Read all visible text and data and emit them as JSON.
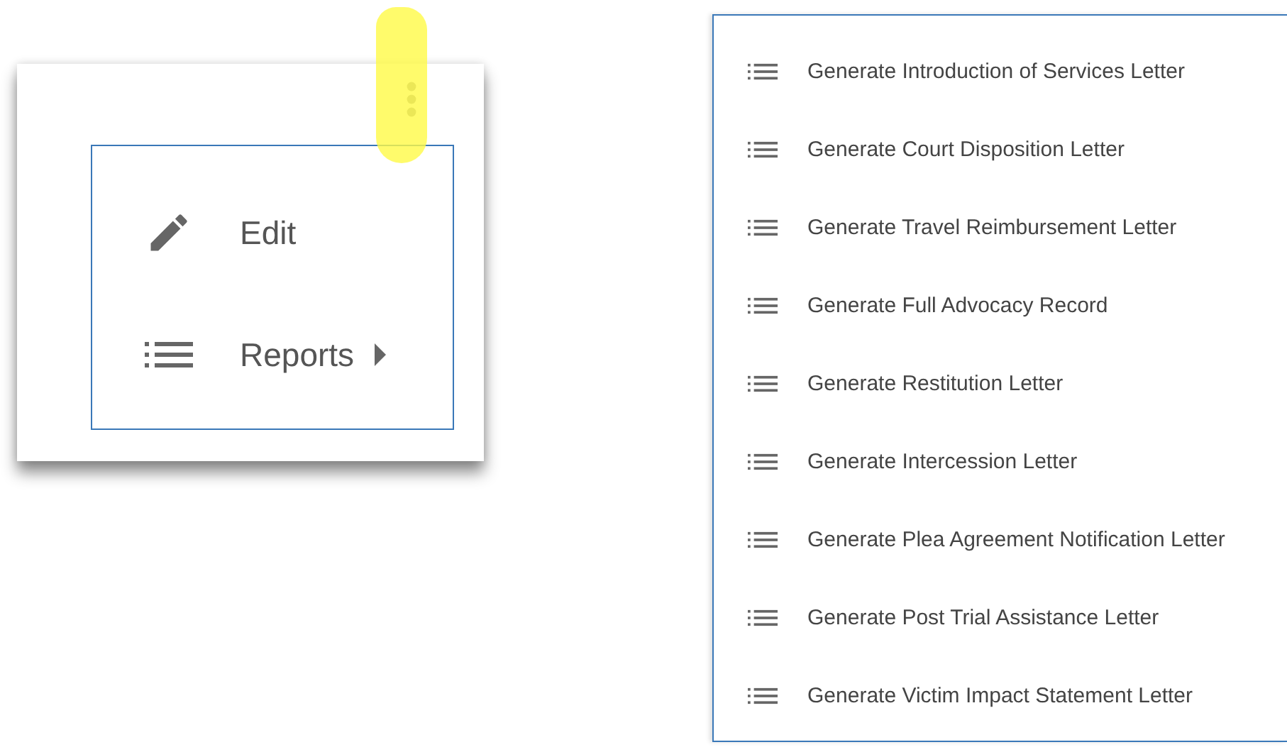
{
  "actions_card": {
    "more_button": {
      "highlighted": true
    },
    "menu": [
      {
        "kind": "edit",
        "label": "Edit",
        "submenu": false
      },
      {
        "kind": "list",
        "label": "Reports",
        "submenu": true
      }
    ]
  },
  "reports_submenu": [
    {
      "label": "Generate Introduction of Services Letter"
    },
    {
      "label": "Generate Court Disposition Letter"
    },
    {
      "label": "Generate Travel Reimbursement Letter"
    },
    {
      "label": "Generate Full Advocacy Record"
    },
    {
      "label": "Generate Restitution Letter"
    },
    {
      "label": "Generate Intercession Letter"
    },
    {
      "label": "Generate Plea Agreement Notification Letter"
    },
    {
      "label": "Generate Post Trial Assistance Letter"
    },
    {
      "label": "Generate Victim Impact Statement Letter"
    }
  ]
}
